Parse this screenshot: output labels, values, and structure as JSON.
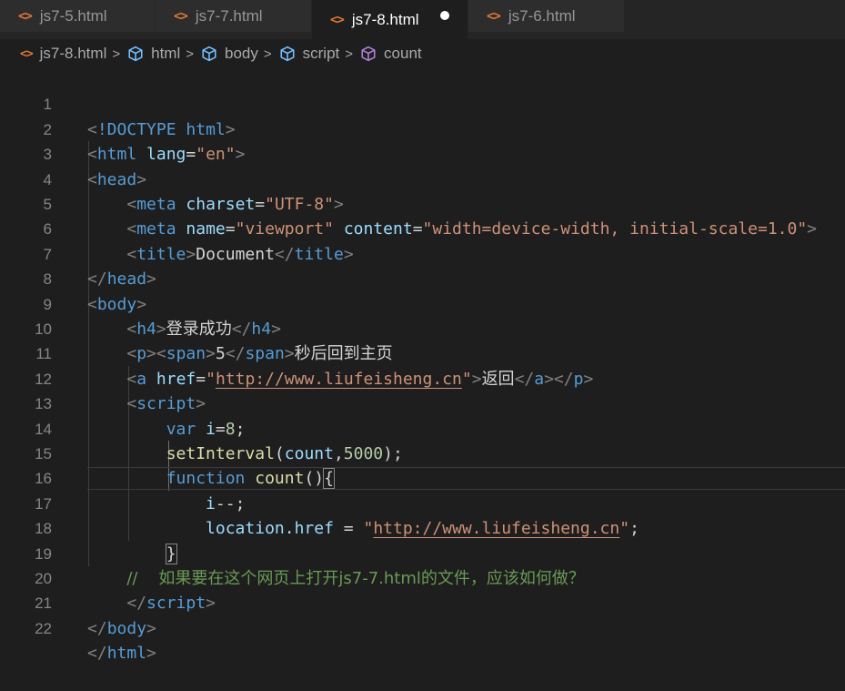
{
  "tabs": [
    {
      "icon": "<>",
      "label": "js7-5.html",
      "active": false,
      "modified": false
    },
    {
      "icon": "<>",
      "label": "js7-7.html",
      "active": false,
      "modified": false
    },
    {
      "icon": "<>",
      "label": "js7-8.html",
      "active": true,
      "modified": true
    },
    {
      "icon": "<>",
      "label": "js7-6.html",
      "active": false,
      "modified": false
    }
  ],
  "breadcrumb": {
    "file": "js7-8.html",
    "items": [
      "html",
      "body",
      "script",
      "count"
    ],
    "separator": ">"
  },
  "line_numbers": [
    "1",
    "2",
    "3",
    "4",
    "5",
    "6",
    "7",
    "8",
    "9",
    "10",
    "11",
    "12",
    "13",
    "14",
    "15",
    "16",
    "17",
    "18",
    "19",
    "20",
    "21",
    "22"
  ],
  "code": {
    "l1_doctype": "!DOCTYPE",
    "l1_html": "html",
    "l2_tag": "html",
    "l2_attr": "lang",
    "l2_val": "\"en\"",
    "l3_tag": "head",
    "l4_tag": "meta",
    "l4_attr": "charset",
    "l4_val": "\"UTF-8\"",
    "l5_tag": "meta",
    "l5_attr1": "name",
    "l5_val1": "\"viewport\"",
    "l5_attr2": "content",
    "l5_val2": "\"width=device-width, initial-scale=1.0\"",
    "l6_tag": "title",
    "l6_text": "Document",
    "l7_tag": "head",
    "l8_tag": "body",
    "l9_tag": "h4",
    "l9_text": "登录成功",
    "l10_tag_p": "p",
    "l10_tag_span": "span",
    "l10_num": "5",
    "l10_text": "秒后回到主页",
    "l11_tag_a": "a",
    "l11_attr": "href",
    "l11_q1": "\"",
    "l11_url": "http://www.liufeisheng.cn",
    "l11_q2": "\"",
    "l11_text": "返回",
    "l11_tag_p": "p",
    "l12_tag": "script",
    "l13_kw": "var",
    "l13_var": "i",
    "l13_eq": "=",
    "l13_num": "8",
    "l13_semi": ";",
    "l14_fn": "setInterval",
    "l14_open": "(",
    "l14_arg": "count",
    "l14_comma": ",",
    "l14_num": "5000",
    "l14_close": ");",
    "l15_kw": "function",
    "l15_fn": "count",
    "l15_paren": "()",
    "l15_brace": "{",
    "l16_var": "i",
    "l16_op": "--;",
    "l17_obj": "location",
    "l17_dot": ".",
    "l17_prop": "href",
    "l17_eq": " = ",
    "l17_q1": "\"",
    "l17_url": "http://www.liufeisheng.cn",
    "l17_q2": "\"",
    "l17_semi": ";",
    "l18_brace": "}",
    "l19_comment": "//    如果要在这个网页上打开js7-7.html的文件，应该如何做？",
    "l20_tag": "script",
    "l21_tag": "body",
    "l22_tag": "html"
  },
  "colors": {
    "background": "#1e1e1e",
    "tag": "#569cd6",
    "attribute": "#9cdcfe",
    "string": "#ce9178",
    "function": "#dcdcaa",
    "number": "#b5cea8",
    "comment": "#6a9955",
    "html_icon": "#e37933",
    "cube_icon": "#75beff",
    "method_icon": "#b180d7"
  },
  "icons": {
    "tab_file": "html-file-icon",
    "crumb_file": "html-file-icon",
    "crumb_element": "symbol-element-cube-icon",
    "crumb_method": "symbol-method-cube-icon",
    "modified": "unsaved-dot-icon"
  }
}
